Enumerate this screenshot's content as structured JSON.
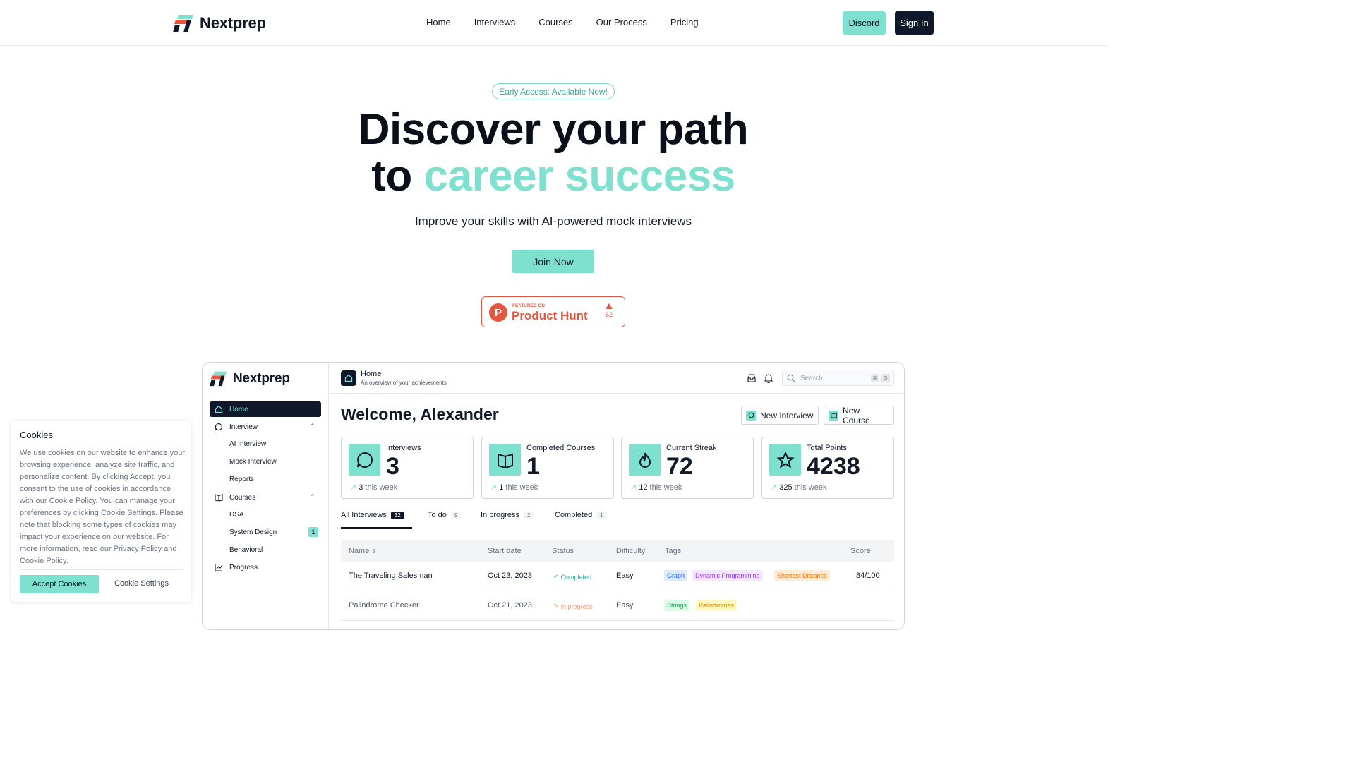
{
  "brand": {
    "name": "Nextprep"
  },
  "nav": {
    "links": [
      "Home",
      "Interviews",
      "Courses",
      "Our Process",
      "Pricing"
    ],
    "discord": "Discord",
    "signin": "Sign In"
  },
  "hero": {
    "pill": "Early Access: Available Now!",
    "line1": "Discover your path",
    "line2_prefix": "to",
    "line2_accent": "career success",
    "subtitle": "Improve your skills with AI-powered mock interviews",
    "cta": "Join Now"
  },
  "product_hunt": {
    "featured": "FEATURED ON",
    "name": "Product Hunt",
    "votes": "62"
  },
  "colors": {
    "accent": "#7ee0cf",
    "dark": "#0f172a",
    "product_hunt": "#e4573f"
  },
  "app": {
    "brand": "Nextprep",
    "sidebar": {
      "home": "Home",
      "interview": "Interview",
      "interview_sub": [
        "AI Interview",
        "Mock Interview",
        "Reports"
      ],
      "courses": "Courses",
      "courses_sub": [
        "DSA",
        "System Design",
        "Behavioral"
      ],
      "system_design_badge": "1",
      "progress": "Progress"
    },
    "header": {
      "title": "Home",
      "subtitle": "An overview of your achievements",
      "search_placeholder": "Search",
      "kbd1": "⌘",
      "kbd2": "S"
    },
    "welcome": "Welcome, Alexander",
    "buttons": {
      "new_interview": "New Interview",
      "new_course": "New Course"
    },
    "stats": [
      {
        "label": "Interviews",
        "value": "3",
        "delta": "3",
        "delta_suffix": "this week",
        "icon": "chat-icon"
      },
      {
        "label": "Completed Courses",
        "value": "1",
        "delta": "1",
        "delta_suffix": "this week",
        "icon": "book-icon"
      },
      {
        "label": "Current Streak",
        "value": "72",
        "delta": "12",
        "delta_suffix": "this week",
        "icon": "flame-icon"
      },
      {
        "label": "Total Points",
        "value": "4238",
        "delta": "325",
        "delta_suffix": "this week",
        "icon": "star-icon"
      }
    ],
    "tabs": [
      {
        "label": "All Interviews",
        "count": "32"
      },
      {
        "label": "To do",
        "count": "9"
      },
      {
        "label": "In progress",
        "count": "2"
      },
      {
        "label": "Completed",
        "count": "1"
      }
    ],
    "table": {
      "columns": [
        "Name",
        "Start date",
        "Status",
        "Difficulty",
        "Tags",
        "Score"
      ],
      "rows": [
        {
          "name": "The Traveling Salesman",
          "date": "Oct 23, 2023",
          "status": "Completed",
          "difficulty": "Easy",
          "tags": [
            "Graph",
            "Dynamic Programming",
            "Shortest Distance"
          ],
          "score": "84/100"
        },
        {
          "name": "Palindrome Checker",
          "date": "Oct 21, 2023",
          "status": "In progress",
          "difficulty": "Easy",
          "tags": [
            "Strings",
            "Palindromes"
          ],
          "score": ""
        }
      ]
    }
  },
  "cookie": {
    "title": "Cookies",
    "body": "We use cookies on our website to enhance your browsing experience, analyze site traffic, and personalize content. By clicking Accept, you consent to the use of cookies in accordance with our Cookie Policy. You can manage your preferences by clicking Cookie Settings. Please note that blocking some types of cookies may impact your experience on our website. For more information, read our Privacy Policy and Cookie Policy.",
    "accept": "Accept Cookies",
    "settings": "Cookie Settings"
  }
}
